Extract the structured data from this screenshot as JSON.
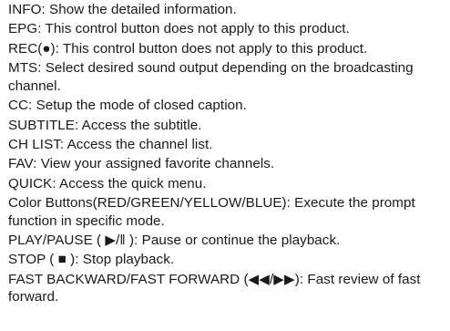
{
  "entries": [
    {
      "text": "INFO: Show the detailed information."
    },
    {
      "text": "EPG: This control button does not apply to this product."
    },
    {
      "text": "REC(●): This control button does not apply to this product."
    },
    {
      "text": "MTS: Select desired sound output depending on the broadcasting channel."
    },
    {
      "text": "CC: Setup the mode of closed caption."
    },
    {
      "text": "SUBTITLE: Access the subtitle."
    },
    {
      "text": "CH LIST: Access the channel list."
    },
    {
      "text": "FAV: View your assigned favorite channels."
    },
    {
      "text": "QUICK: Access the quick menu."
    },
    {
      "text": "Color Buttons(RED/GREEN/YELLOW/BLUE): Execute the prompt function in specific mode."
    },
    {
      "text": "PLAY/PAUSE ( ▶/‖ ): Pause or continue the playback."
    },
    {
      "text": "STOP ( ■ ): Stop playback."
    },
    {
      "text": "FAST BACKWARD/FAST FORWARD (◀◀/▶▶): Fast review of fast forward."
    }
  ]
}
